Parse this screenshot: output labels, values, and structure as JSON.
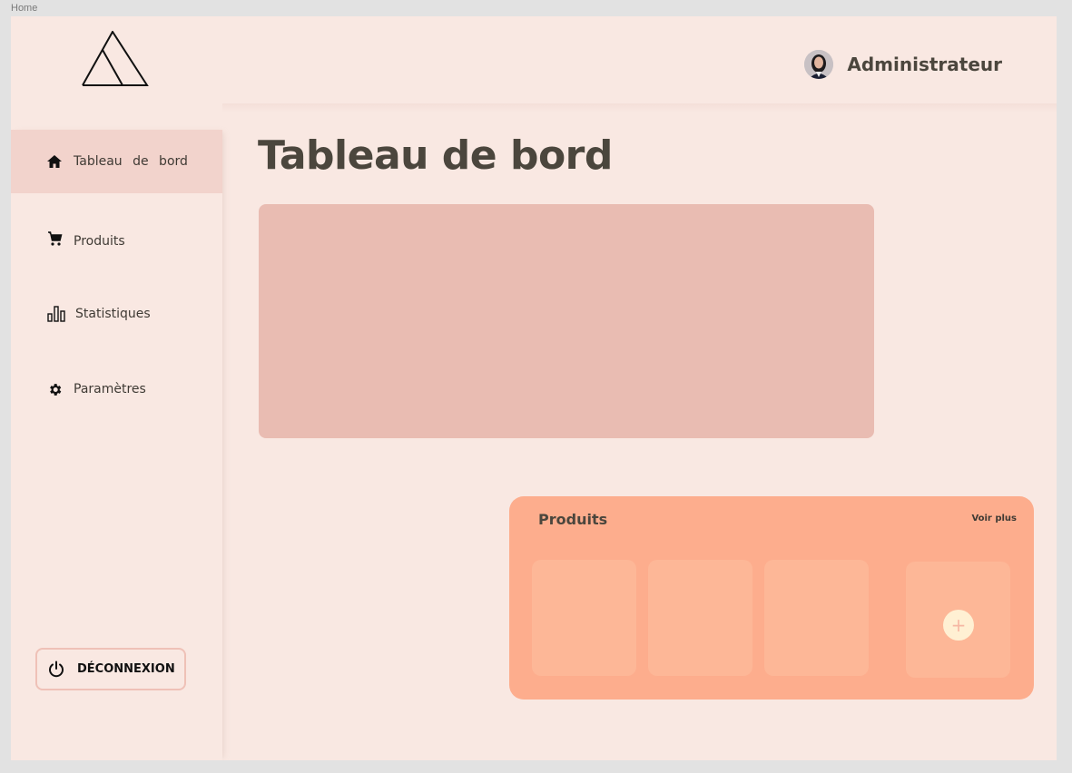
{
  "frame_label": "Home",
  "header": {
    "user_name": "Administrateur"
  },
  "sidebar": {
    "items": [
      {
        "label": "Tableau de bord",
        "icon": "home-icon",
        "active": true
      },
      {
        "label": "Produits",
        "icon": "cart-icon",
        "active": false
      },
      {
        "label": "Statistiques",
        "icon": "bar-chart-icon",
        "active": false
      },
      {
        "label": "Paramètres",
        "icon": "gear-icon",
        "active": false
      }
    ],
    "logout_label": "DÉCONNEXION"
  },
  "main": {
    "title": "Tableau de bord",
    "products": {
      "title": "Produits",
      "see_more": "Voir plus",
      "add_label": "+"
    }
  },
  "colors": {
    "background": "#f9e8e2",
    "active_nav": "#f2d3cc",
    "hero_card": "#e9bcb2",
    "products_panel": "#fdad8d",
    "product_card": "#fdb797",
    "text": "#4b463d"
  }
}
